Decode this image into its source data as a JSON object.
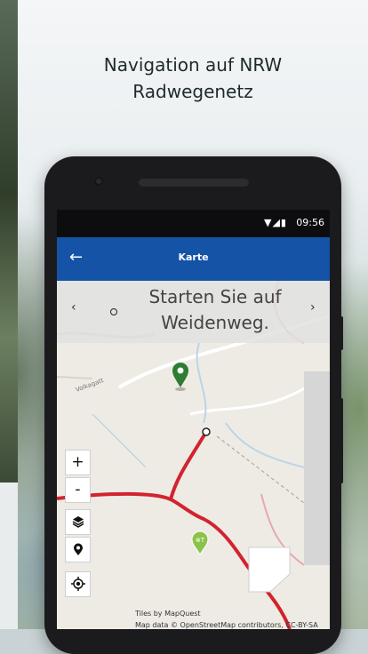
{
  "headline": {
    "line1": "Navigation auf NRW",
    "line2": "Radwegenetz"
  },
  "status_bar": {
    "time": "09:56",
    "icons": "▼◢▮"
  },
  "app_bar": {
    "back_icon": "arrow-left-icon",
    "back_glyph": "←",
    "title": "Karte"
  },
  "navigation_banner": {
    "prev_glyph": "‹",
    "next_glyph": "›",
    "instruction": "Starten Sie auf Weidenweg."
  },
  "map": {
    "street_label": "Volkagatt",
    "route_color": "#d2232f",
    "marker_color": "#2e7d32",
    "marker_pin_label": "⊗T"
  },
  "map_controls": {
    "zoom_in": "+",
    "zoom_out": "-",
    "layers_icon": "layers-icon",
    "pin_icon": "location-pin-icon",
    "locate_icon": "gps-locate-icon"
  },
  "attribution": {
    "tiles": "Tiles by MapQuest",
    "data": "Map data © OpenStreetMap contributors, CC-BY-SA"
  }
}
